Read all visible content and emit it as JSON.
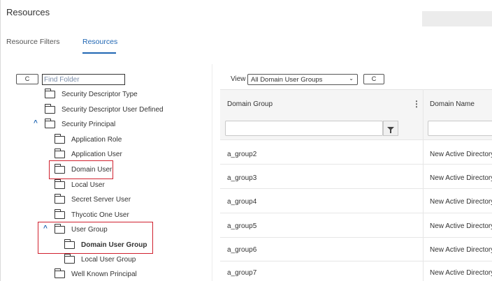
{
  "header": {
    "title": "Resources"
  },
  "tabs": [
    {
      "label": "Resource Filters"
    },
    {
      "label": "Resources"
    }
  ],
  "tree": {
    "refresh_label": "C",
    "find_placeholder": "Find Folder",
    "items": [
      {
        "label": "Security Descriptor Type"
      },
      {
        "label": "Security Descriptor User Defined"
      },
      {
        "label": "Security Principal",
        "expanded": true
      },
      {
        "label": "Application Role"
      },
      {
        "label": "Application User"
      },
      {
        "label": "Domain User"
      },
      {
        "label": "Local User"
      },
      {
        "label": "Secret Server User"
      },
      {
        "label": "Thycotic One User"
      },
      {
        "label": "User Group",
        "expanded": true
      },
      {
        "label": "Domain User Group",
        "selected": true
      },
      {
        "label": "Local User Group"
      },
      {
        "label": "Well Known Principal"
      }
    ],
    "expand_icon": "chevron-up",
    "highlight_color": "#d0202e"
  },
  "grid": {
    "view_label": "View",
    "view_selected": "All Domain User Groups",
    "refresh_label": "C",
    "columns": [
      {
        "label": "Domain Group"
      },
      {
        "label": "Domain Name"
      }
    ],
    "rows": [
      {
        "group": "a_group2",
        "domain": "New Active Directory"
      },
      {
        "group": "a_group3",
        "domain": "New Active Directory"
      },
      {
        "group": "a_group4",
        "domain": "New Active Directory"
      },
      {
        "group": "a_group5",
        "domain": "New Active Directory"
      },
      {
        "group": "a_group6",
        "domain": "New Active Directory"
      },
      {
        "group": "a_group7",
        "domain": "New Active Directory"
      }
    ]
  },
  "colors": {
    "accent": "#1f66b3",
    "highlight": "#d0202e"
  }
}
